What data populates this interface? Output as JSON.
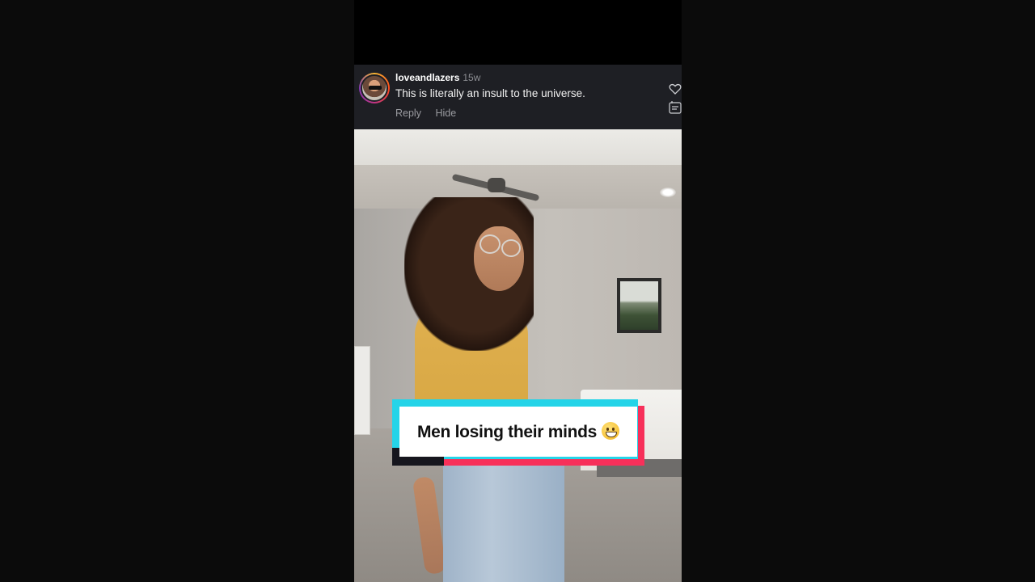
{
  "comment": {
    "username": "loveandlazers",
    "age": "15w",
    "text": "This is literally an insult to the universe.",
    "actions": {
      "reply_label": "Reply",
      "hide_label": "Hide"
    }
  },
  "video": {
    "caption": "Men losing their minds",
    "caption_emoji": "grinning-face-emoji"
  },
  "colors": {
    "caption_cyan": "#25d4e8",
    "caption_red": "#f7305a",
    "comment_bg": "#1e1f24",
    "shirt_yellow": "#e0b050"
  }
}
